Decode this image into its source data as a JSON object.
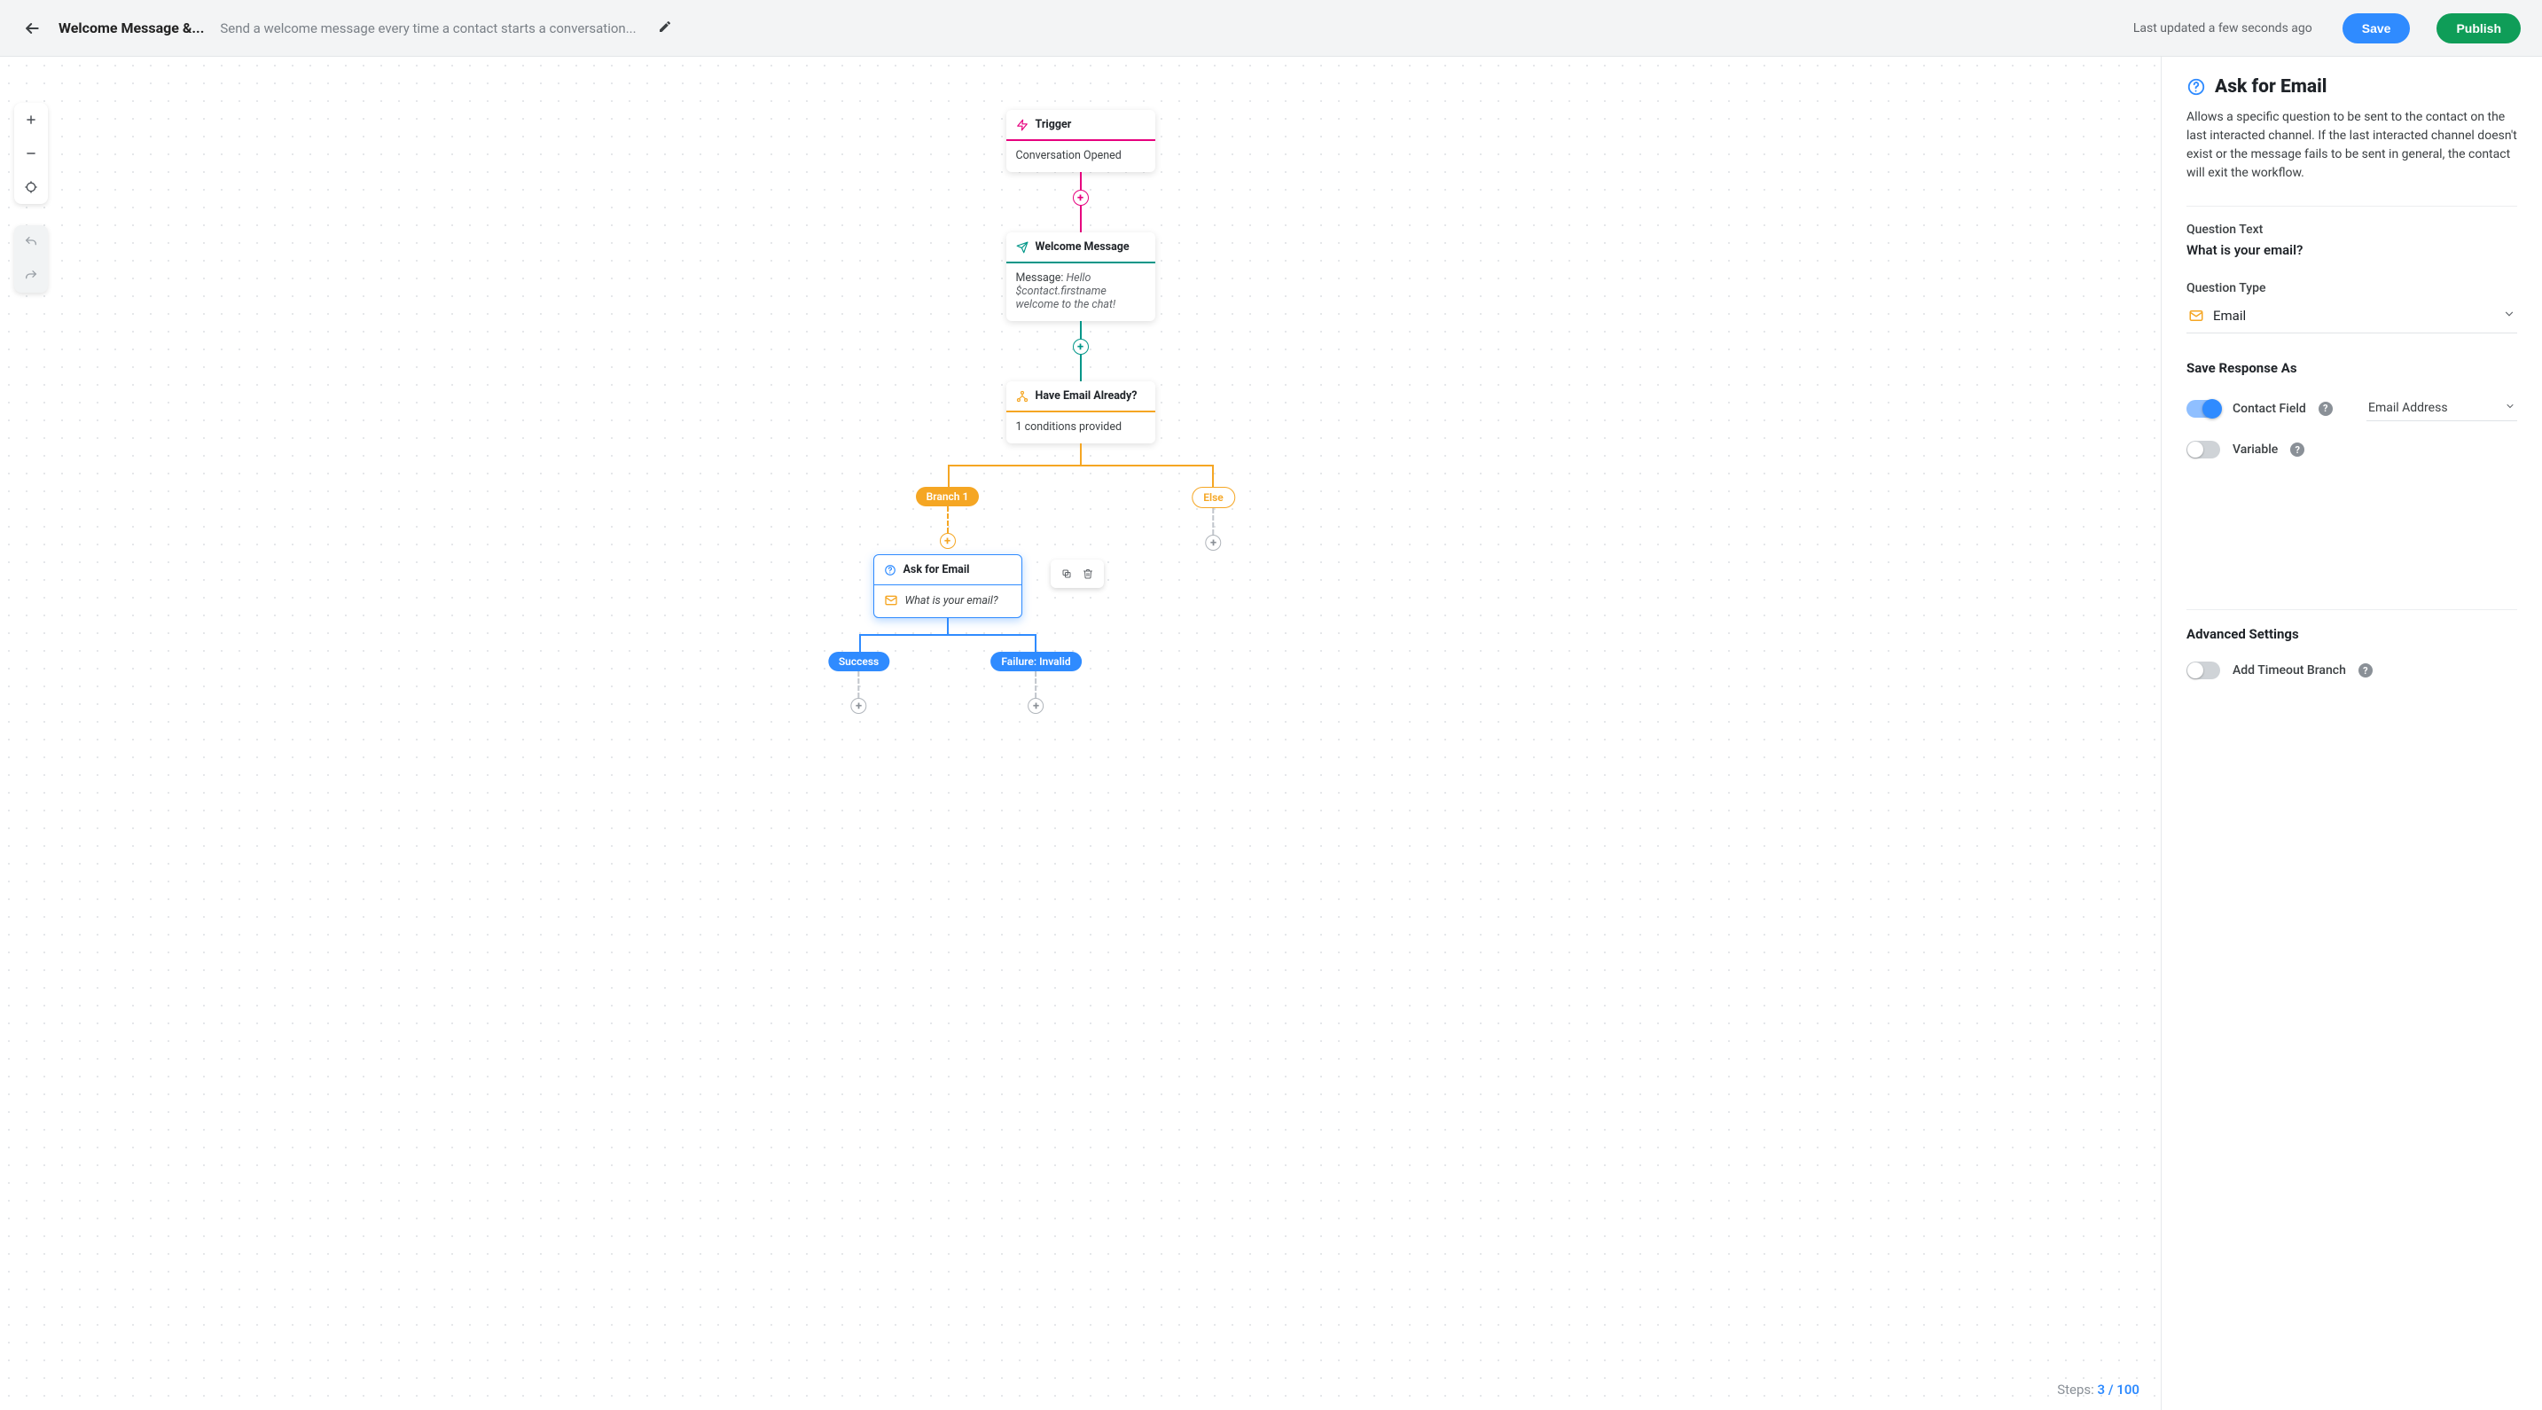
{
  "header": {
    "title": "Welcome Message &...",
    "description": "Send a welcome message every time a contact starts a conversation...",
    "last_updated": "Last updated a few seconds ago",
    "save_label": "Save",
    "publish_label": "Publish"
  },
  "canvas": {
    "steps_prefix": "Steps:",
    "steps_count": "3",
    "steps_total": "/ 100"
  },
  "flow": {
    "trigger": {
      "title": "Trigger",
      "body": "Conversation Opened"
    },
    "welcome": {
      "title": "Welcome Message",
      "body_prefix": "Message: ",
      "body_italic": "Hello $contact.firstname welcome to the chat!"
    },
    "branch": {
      "title": "Have Email Already?",
      "body": "1 conditions provided"
    },
    "branch_labels": {
      "b1": "Branch 1",
      "else": "Else"
    },
    "ask": {
      "title": "Ask for Email",
      "question": "What is your email?"
    },
    "outcomes": {
      "success": "Success",
      "failure": "Failure: Invalid"
    }
  },
  "panel": {
    "title": "Ask for Email",
    "description": "Allows a specific question to be sent to the contact on the last interacted channel. If the last interacted channel doesn't exist or the message fails to be sent in general, the contact will exit the workflow.",
    "question_text_label": "Question Text",
    "question_text_value": "What is your email?",
    "question_type_label": "Question Type",
    "question_type_value": "Email",
    "save_response_label": "Save Response As",
    "contact_field_label": "Contact Field",
    "contact_field_value": "Email Address",
    "variable_label": "Variable",
    "advanced_label": "Advanced Settings",
    "timeout_label": "Add Timeout Branch"
  }
}
